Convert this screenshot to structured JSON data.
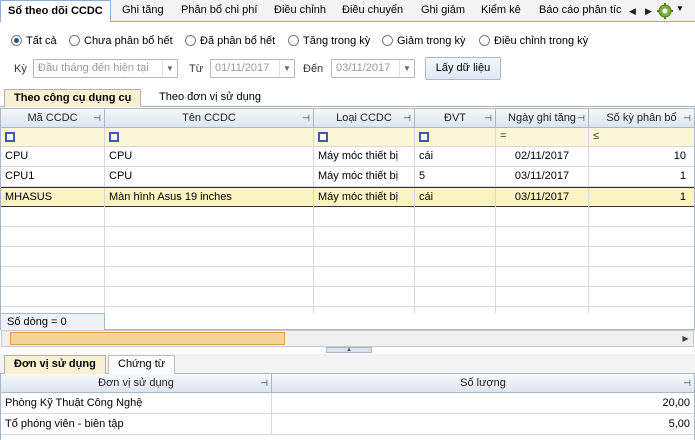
{
  "top_tabs": [
    {
      "label": "Sổ theo dõi CCDC",
      "active": true
    },
    {
      "label": "Ghi tăng"
    },
    {
      "label": "Phân bổ chi phí"
    },
    {
      "label": "Điều chỉnh"
    },
    {
      "label": "Điều chuyển"
    },
    {
      "label": "Ghi giảm"
    },
    {
      "label": "Kiểm kê"
    },
    {
      "label": "Báo cáo phân tíc"
    }
  ],
  "filters": {
    "radios": [
      {
        "label": "Tất cả",
        "checked": true
      },
      {
        "label": "Chưa phân bổ hết"
      },
      {
        "label": "Đã phân bổ hết"
      },
      {
        "label": "Tăng trong kỳ"
      },
      {
        "label": "Giảm trong kỳ"
      },
      {
        "label": "Điều chỉnh trong kỳ"
      }
    ],
    "period_label": "Kỳ",
    "period_value": "Đầu tháng đến hiện tại",
    "from_label": "Từ",
    "from_value": "01/11/2017",
    "to_label": "Đến",
    "to_value": "03/11/2017",
    "load_button": "Lấy dữ liệu"
  },
  "sub_tabs": [
    {
      "label": "Theo công cụ dụng cụ",
      "active": true
    },
    {
      "label": "Theo đơn vị sử dụng"
    }
  ],
  "grid": {
    "columns": [
      "Mã CCDC",
      "Tên CCDC",
      "Loại CCDC",
      "ĐVT",
      "Ngày ghi tăng",
      "Số kỳ phân bổ"
    ],
    "filter_ops": [
      "",
      "",
      "",
      "",
      "=",
      "≤"
    ],
    "rows": [
      {
        "code": "CPU",
        "name": "CPU",
        "type": "Máy móc thiết bị",
        "unit": "cái",
        "date": "02/11/2017",
        "periods": "10"
      },
      {
        "code": "CPU1",
        "name": "CPU",
        "type": "Máy móc thiết bị",
        "unit": "5",
        "date": "03/11/2017",
        "periods": "1"
      },
      {
        "code": "MHASUS",
        "name": "Màn hình Asus 19 inches",
        "type": "Máy móc thiết bị",
        "unit": "cái",
        "date": "03/11/2017",
        "periods": "1",
        "selected": true
      }
    ],
    "row_count": "Số dòng = 0"
  },
  "bottom_tabs": [
    {
      "label": "Đơn vị sử dụng",
      "active": true
    },
    {
      "label": "Chứng từ"
    }
  ],
  "bottom_grid": {
    "columns": [
      "Đơn vị sử dụng",
      "Số lượng"
    ],
    "rows": [
      {
        "unit": "Phòng Kỹ Thuật Công Nghệ",
        "qty": "20,00"
      },
      {
        "unit": "Tổ phóng viên - biên tập",
        "qty": "5,00"
      }
    ]
  },
  "colors": {
    "accent": "#2b4f9e",
    "selected_row": "#fbf3c2",
    "filter_row": "#fbf6d8",
    "scroll_thumb": "#f5d49a"
  }
}
